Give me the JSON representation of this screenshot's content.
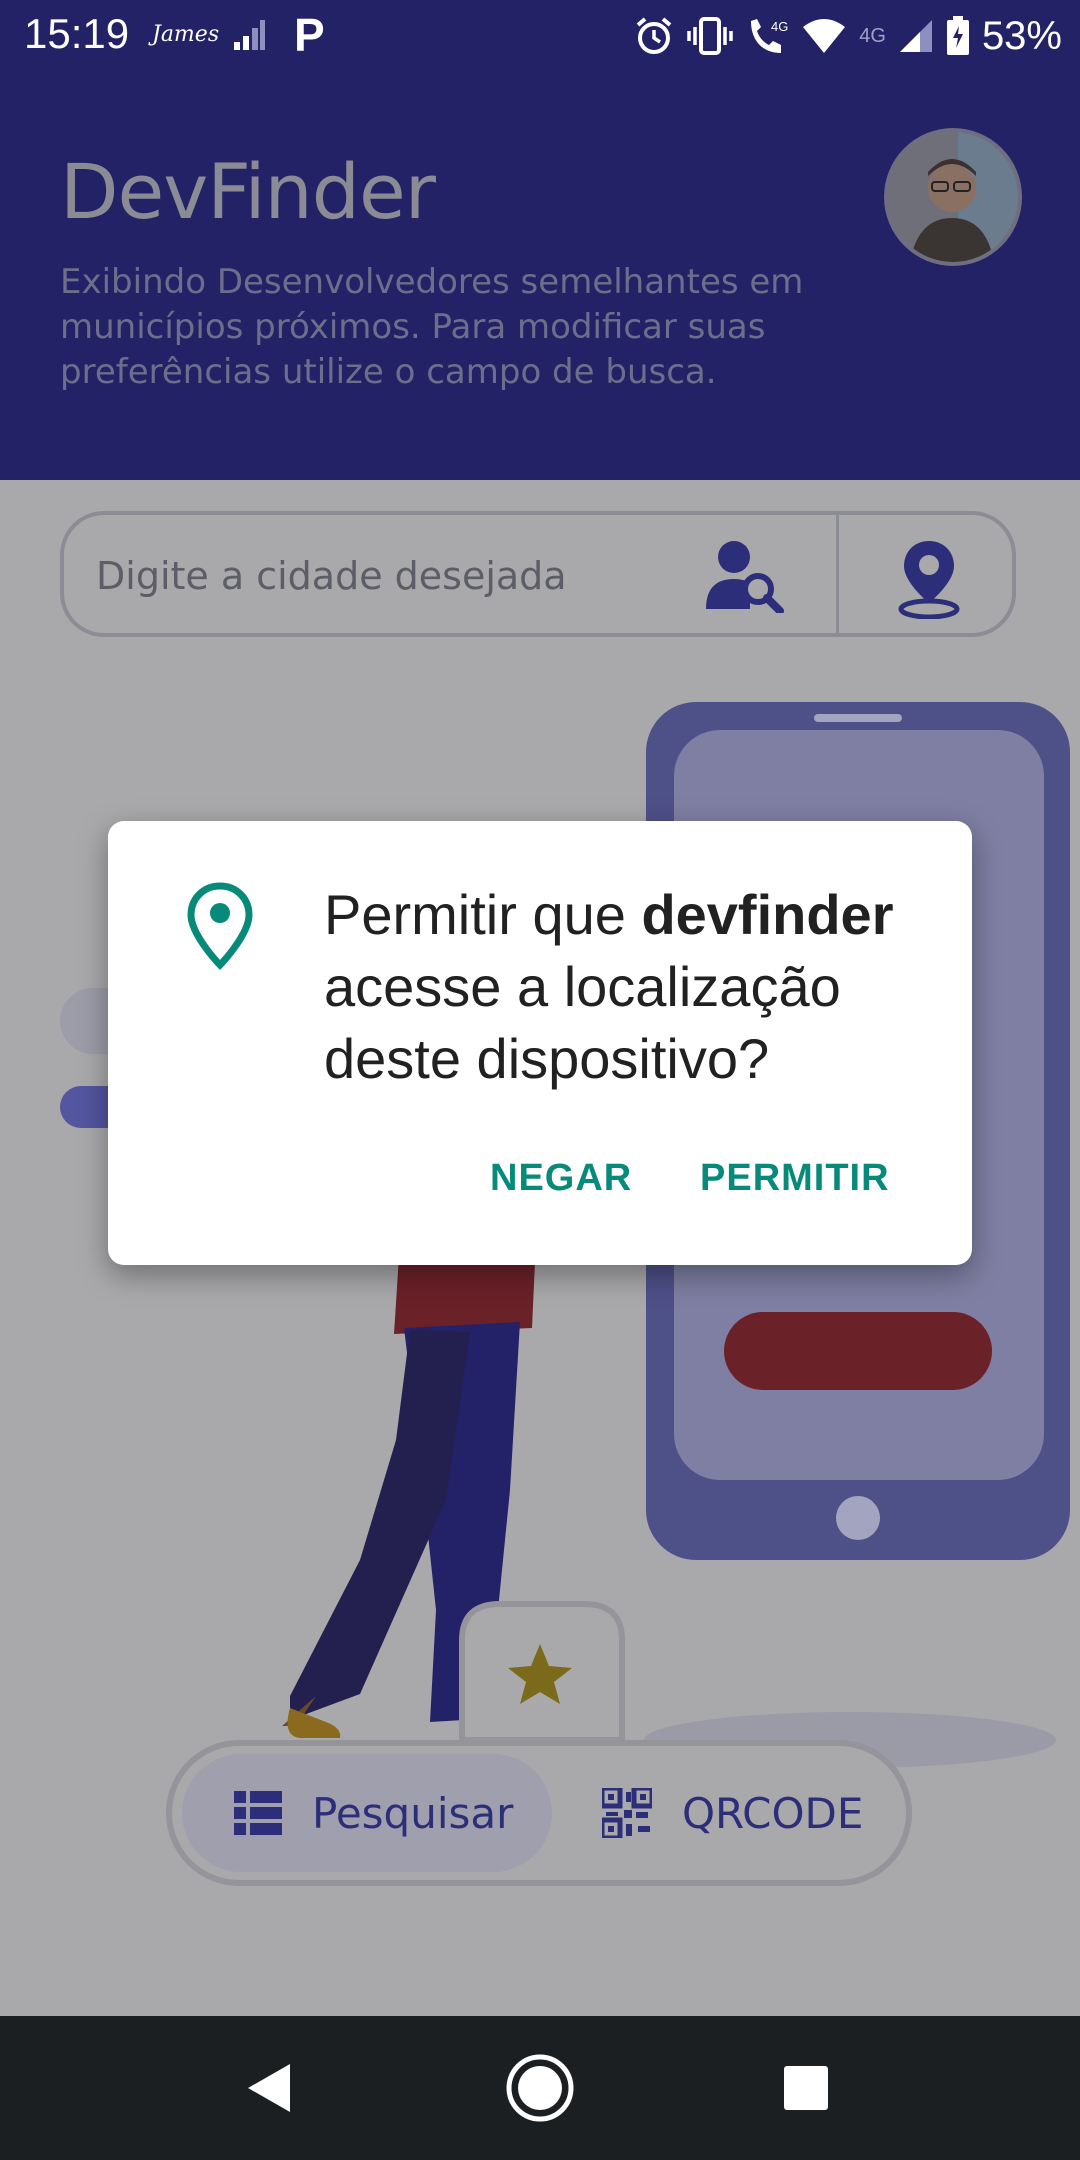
{
  "status_bar": {
    "time": "15:19",
    "carrier_label": "James",
    "app_badge": "P",
    "network_labels": [
      "4G",
      "4G"
    ],
    "battery": "53%",
    "icons": [
      "signal-bars-icon",
      "alarm-icon",
      "vibrate-icon",
      "wifi-call-icon",
      "wifi-icon",
      "cell-signal-icon",
      "battery-icon"
    ]
  },
  "header": {
    "title": "DevFinder",
    "subtitle": "Exibindo Desenvolvedores semelhantes em municípios próximos. Para modificar suas preferências utilize o campo de busca.",
    "avatar": "user-avatar"
  },
  "search": {
    "placeholder": "Digite a cidade desejada",
    "value": "",
    "search_icon": "user-search-icon",
    "location_icon": "location-pin-icon"
  },
  "tabs": [
    {
      "label": "Pesquisar",
      "icon": "list-icon",
      "active": true
    },
    {
      "label": "QRCODE",
      "icon": "qrcode-icon",
      "active": false
    }
  ],
  "dialog": {
    "icon": "location-pin-icon",
    "message_prefix": "Permitir que ",
    "app_name": "devfinder",
    "message_suffix": " acesse a localização deste dispositivo?",
    "deny_label": "NEGAR",
    "allow_label": "PERMITIR",
    "accent_color": "#088a7b"
  },
  "nav_bar": {
    "buttons": [
      "back-icon",
      "home-icon",
      "recents-icon"
    ]
  },
  "colors": {
    "primary": "#232266",
    "scrim_background": "#a9a9ab",
    "illustration_red": "#6b2128"
  }
}
